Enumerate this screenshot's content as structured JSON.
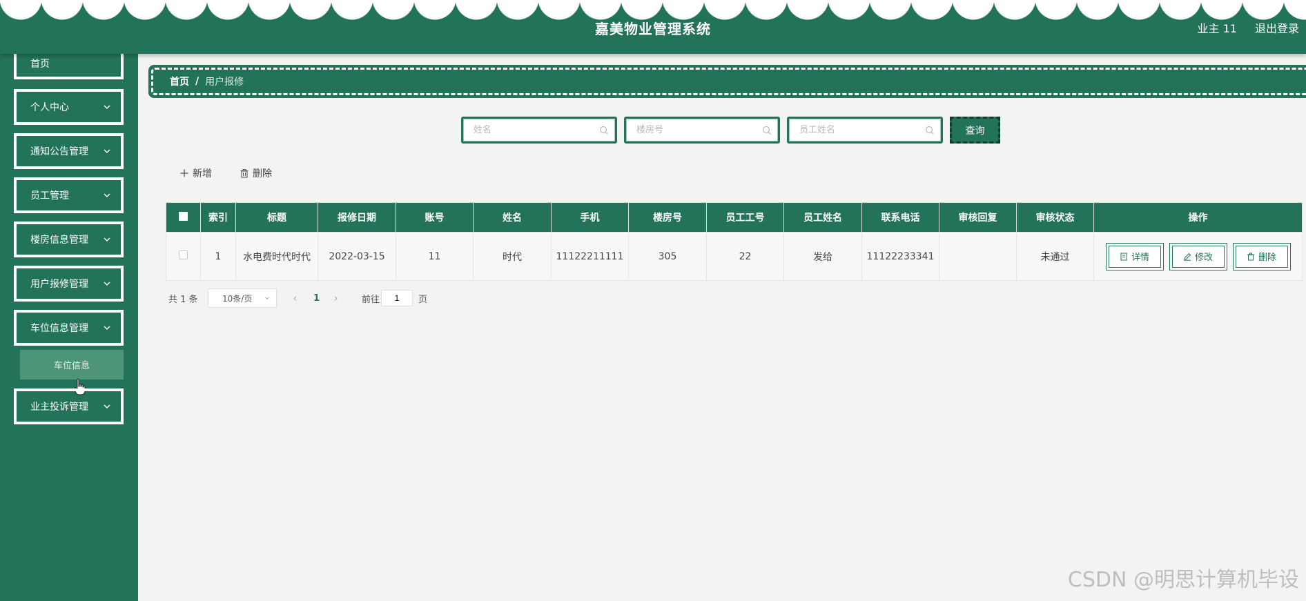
{
  "header": {
    "title": "嘉美物业管理系统",
    "user": "业主 11",
    "logout": "退出登录"
  },
  "sidebar": {
    "items": [
      {
        "label": "首页"
      },
      {
        "label": "个人中心"
      },
      {
        "label": "通知公告管理"
      },
      {
        "label": "员工管理"
      },
      {
        "label": "楼房信息管理"
      },
      {
        "label": "用户报修管理"
      },
      {
        "label": "车位信息管理"
      },
      {
        "label": "业主投诉管理"
      }
    ],
    "submenu": {
      "label": "车位信息"
    }
  },
  "breadcrumb": {
    "home": "首页",
    "separator": "/",
    "current": "用户报修"
  },
  "search": {
    "name_placeholder": "姓名",
    "building_placeholder": "楼房号",
    "staff_placeholder": "员工姓名",
    "query_label": "查询"
  },
  "actions": {
    "add_label": "新增",
    "delete_label": "删除"
  },
  "table": {
    "headers": [
      "索引",
      "标题",
      "报修日期",
      "账号",
      "姓名",
      "手机",
      "楼房号",
      "员工工号",
      "员工姓名",
      "联系电话",
      "审核回复",
      "审核状态",
      "操作"
    ],
    "rows": [
      {
        "index": "1",
        "title": "水电费时代时代",
        "date": "2022-03-15",
        "account": "11",
        "name": "时代",
        "phone": "11122211111",
        "building": "305",
        "staff_no": "22",
        "staff_name": "发给",
        "contact": "11122233341",
        "reply": "",
        "status": "未通过"
      }
    ],
    "op_labels": {
      "detail": "详情",
      "edit": "修改",
      "delete": "删除"
    }
  },
  "pagination": {
    "total": "共 1 条",
    "page_size": "10条/页",
    "current_page": "1",
    "goto_prefix": "前往",
    "goto_value": "1",
    "goto_suffix": "页"
  },
  "watermark": "CSDN @明思计算机毕设",
  "colors": {
    "primary": "#23735a",
    "submenu": "#4e9479",
    "background": "#f3f4f2"
  }
}
